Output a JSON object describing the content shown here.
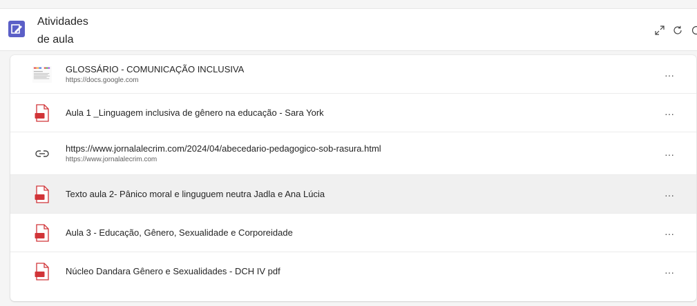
{
  "header": {
    "title_line1": "Atividades",
    "title_line2": "de aula",
    "app_icon": "edit-document-icon",
    "buttons": {
      "expand": "expand-icon",
      "refresh": "refresh-icon",
      "more": "more-icon"
    }
  },
  "colors": {
    "brand": "#5b5fc7",
    "pdf_red": "#d13438"
  },
  "items": [
    {
      "title": "GLOSSÁRIO - COMUNICAÇÃO INCLUSIVA",
      "subtitle": "https://docs.google.com",
      "icon": "document-thumbnail",
      "more": "···"
    },
    {
      "title": "Aula 1 _Linguagem inclusiva de gênero na educação - Sara York",
      "subtitle": "",
      "icon": "pdf-file-icon",
      "more": "···"
    },
    {
      "title": "https://www.jornalalecrim.com/2024/04/abecedario-pedagogico-sob-rasura.html",
      "subtitle": "https://www.jornalalecrim.com",
      "icon": "link-icon",
      "more": "···"
    },
    {
      "title": "Texto aula 2- Pânico moral e linguguem neutra Jadla e Ana Lúcia",
      "subtitle": "",
      "icon": "pdf-file-icon",
      "more": "···"
    },
    {
      "title": "Aula 3 - Educação, Gênero, Sexualidade e Corporeidade",
      "subtitle": "",
      "icon": "pdf-file-icon",
      "more": "···"
    },
    {
      "title": "Núcleo Dandara Gênero e Sexualidades - DCH IV pdf",
      "subtitle": "",
      "icon": "pdf-file-icon",
      "more": "···"
    }
  ]
}
